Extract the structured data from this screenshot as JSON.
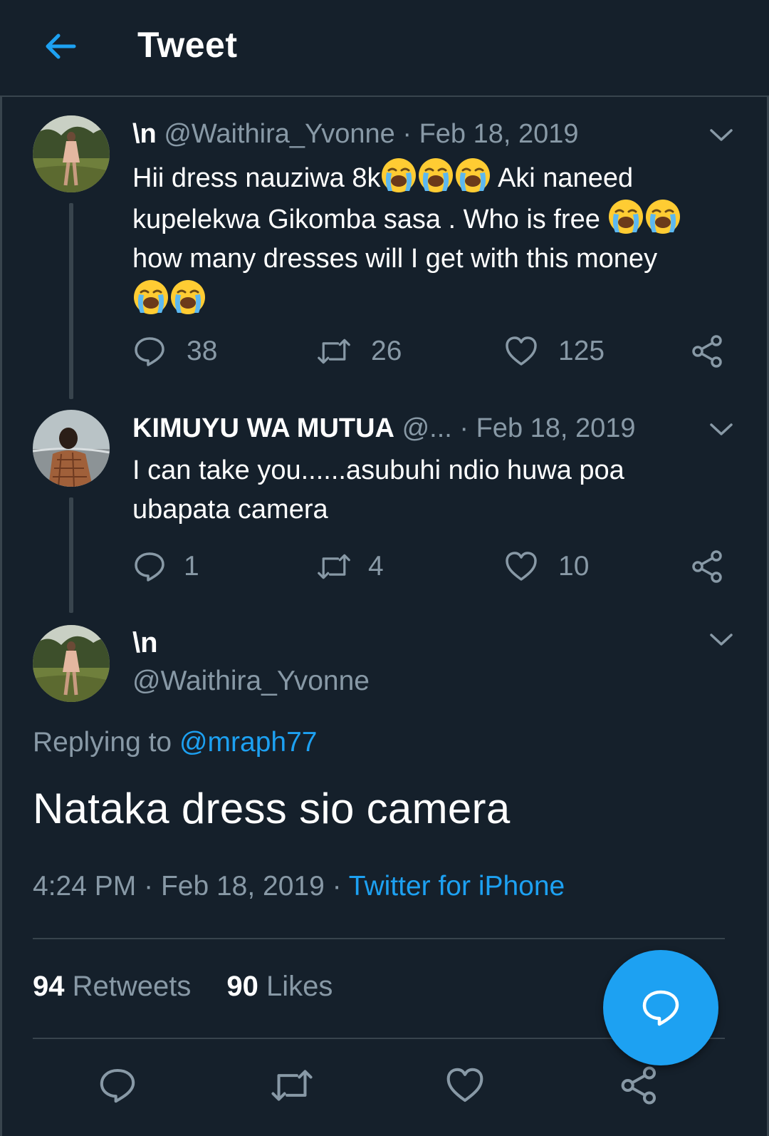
{
  "header": {
    "title": "Tweet",
    "back_icon": "arrow-left-icon"
  },
  "colors": {
    "background": "#15202b",
    "accent": "#1da1f2",
    "muted": "#8899a6",
    "border": "#38444d"
  },
  "thread": [
    {
      "name": "\\n",
      "handle": "@Waithira_Yvonne",
      "separator": "·",
      "date": "Feb 18, 2019",
      "lines": [
        {
          "text": "Hii dress nauziwa  8k",
          "emojis": 3,
          "after": " Aki naneed"
        },
        {
          "text": "kupelekwa Gikomba sasa . Who is free ",
          "emojis": 2,
          "after": ""
        },
        {
          "text": " how many dresses will I get with this money",
          "emojis": 0,
          "after": ""
        },
        {
          "text": "",
          "emojis": 2,
          "after": ""
        }
      ],
      "emoji_name": "loudly-crying-face",
      "replies": "38",
      "retweets": "26",
      "likes": "125"
    },
    {
      "name": "KIMUYU WA MUTUA",
      "handle": "@...",
      "separator": "·",
      "date": "Feb 18, 2019",
      "lines": [
        {
          "text": "I can take you......asubuhi ndio huwa poa",
          "emojis": 0,
          "after": ""
        },
        {
          "text": "ubapata camera",
          "emojis": 0,
          "after": ""
        }
      ],
      "replies": "1",
      "retweets": "4",
      "likes": "10"
    }
  ],
  "focused": {
    "name": "\\n",
    "handle": "@Waithira_Yvonne",
    "replying_prefix": "Replying to ",
    "replying_to": "@mraph77",
    "text": "Nataka dress sio camera",
    "time": "4:24 PM",
    "date": "Feb 18, 2019",
    "sep": "·",
    "client": "Twitter for iPhone",
    "retweets_count": "94",
    "retweets_label": "Retweets",
    "likes_count": "90",
    "likes_label": "Likes"
  },
  "fab": {
    "icon": "compose-reply-icon"
  }
}
